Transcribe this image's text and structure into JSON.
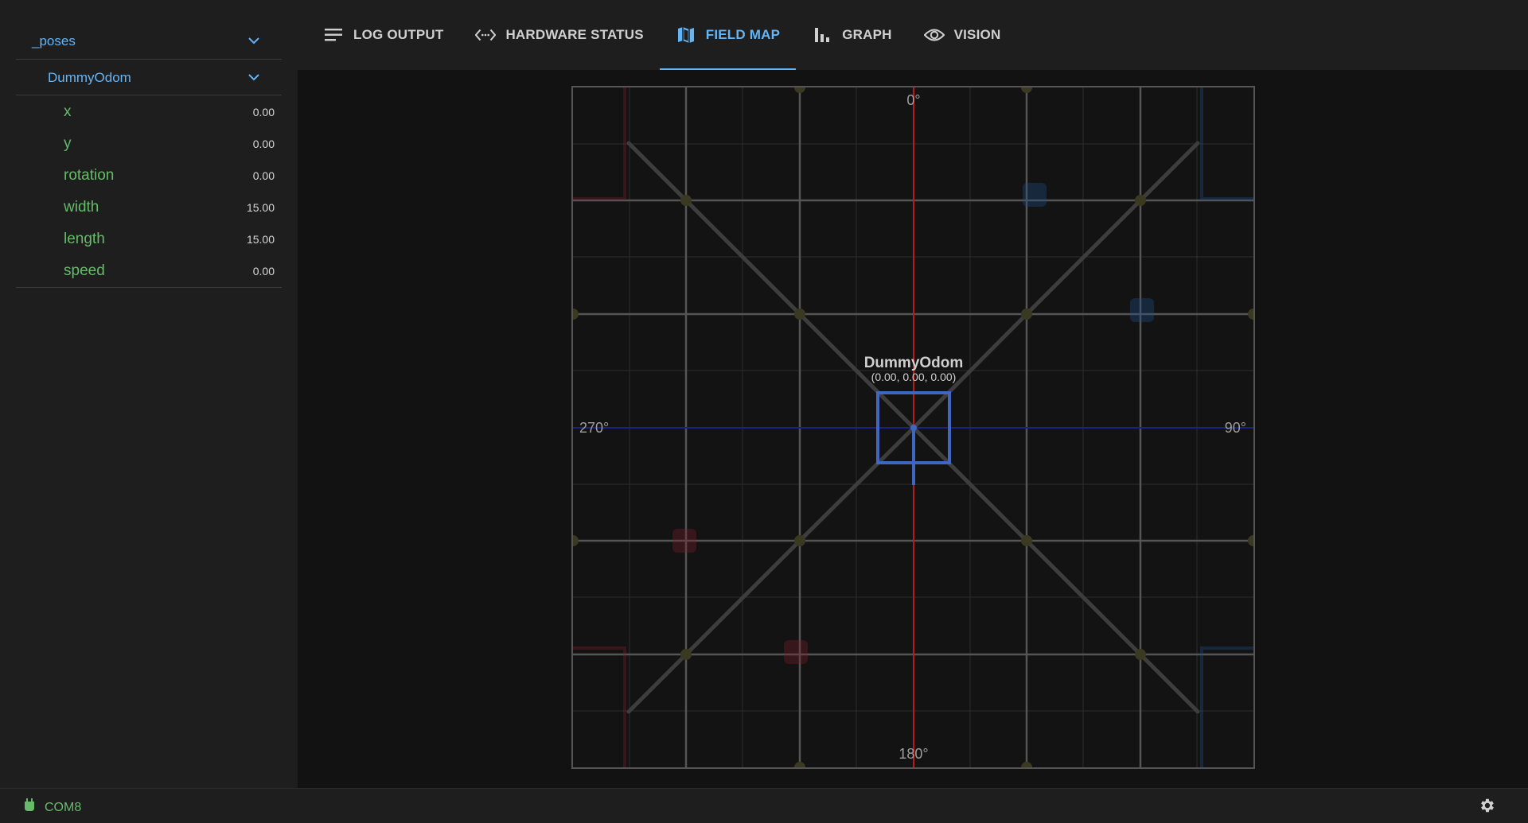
{
  "sidebar": {
    "group": {
      "label": "_poses"
    },
    "subgroup": {
      "label": "DummyOdom"
    },
    "properties": [
      {
        "name": "x",
        "value": "0.00"
      },
      {
        "name": "y",
        "value": "0.00"
      },
      {
        "name": "rotation",
        "value": "0.00"
      },
      {
        "name": "width",
        "value": "15.00"
      },
      {
        "name": "length",
        "value": "15.00"
      },
      {
        "name": "speed",
        "value": "0.00"
      }
    ]
  },
  "tabs": [
    {
      "label": "LOG OUTPUT",
      "icon": "list-icon",
      "active": false
    },
    {
      "label": "HARDWARE STATUS",
      "icon": "code-icon",
      "active": false
    },
    {
      "label": "FIELD MAP",
      "icon": "map-icon",
      "active": true
    },
    {
      "label": "GRAPH",
      "icon": "bar-chart-icon",
      "active": false
    },
    {
      "label": "VISION",
      "icon": "eye-icon",
      "active": false
    }
  ],
  "field": {
    "heading_labels": {
      "top": "0°",
      "right": "90°",
      "bottom": "180°",
      "left": "270°"
    },
    "robot": {
      "name": "DummyOdom",
      "coords": "(0.00, 0.00, 0.00)",
      "x": 0,
      "y": 0,
      "rotation": 0
    }
  },
  "status": {
    "connection": "COM8"
  },
  "colors": {
    "accent": "#64b5f6",
    "green": "#66bb6a",
    "robot": "#3f67c0",
    "axis_red": "#b71c1c",
    "axis_blue": "#1a237e"
  }
}
